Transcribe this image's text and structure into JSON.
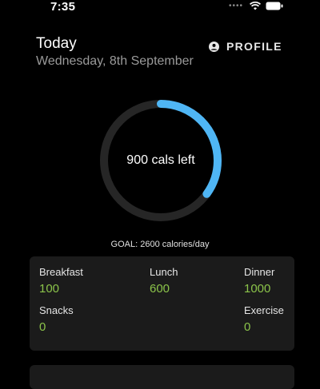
{
  "status": {
    "time": "7:35"
  },
  "header": {
    "title": "Today",
    "date": "Wednesday, 8th September",
    "profile_label": "PROFILE"
  },
  "ring": {
    "label": "900 cals left",
    "fraction_remaining": 0.35,
    "color": "#4fb6f5"
  },
  "goal_text": "GOAL: 2600 calories/day",
  "meals": {
    "breakfast": {
      "label": "Breakfast",
      "value": "100"
    },
    "lunch": {
      "label": "Lunch",
      "value": "600"
    },
    "dinner": {
      "label": "Dinner",
      "value": "1000"
    },
    "snacks": {
      "label": "Snacks",
      "value": "0"
    },
    "exercise": {
      "label": "Exercise",
      "value": "0"
    }
  },
  "colors": {
    "accent": "#4fb6f5",
    "value_green": "#8bc34a",
    "card_bg": "#1b1b1b"
  }
}
